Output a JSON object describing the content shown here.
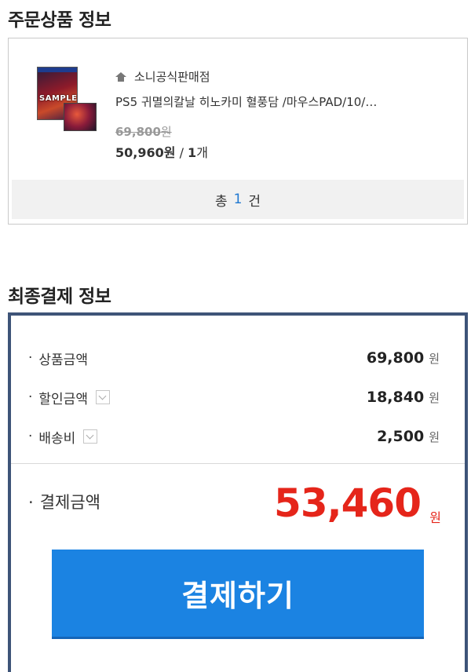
{
  "order_section": {
    "title": "주문상품 정보",
    "store_name": "소니공식판매점",
    "product_name": "PS5 귀멸의칼날 히노카미 혈풍담 /마우스PAD/10/…",
    "original_price": "69,800",
    "original_unit": "원",
    "sale_price": "50,960",
    "sale_unit": "원",
    "separator": " / ",
    "quantity": "1",
    "quantity_unit": "개",
    "thumbnail_icon": "product-thumbnail",
    "thumbnail_text": "SAMPLE",
    "total_prefix": "총",
    "total_count": "1",
    "total_suffix": "건"
  },
  "payment_section": {
    "title": "최종결제 정보",
    "rows": [
      {
        "label": "상품금액",
        "amount": "69,800",
        "unit": "원",
        "has_toggle": false
      },
      {
        "label": "할인금액",
        "amount": "18,840",
        "unit": "원",
        "has_toggle": true
      },
      {
        "label": "배송비",
        "amount": "2,500",
        "unit": "원",
        "has_toggle": true
      }
    ],
    "bullet": "·",
    "final_label": "결제금액",
    "final_amount": "53,460",
    "final_unit": "원",
    "pay_button_label": "결제하기"
  },
  "colors": {
    "accent_blue": "#1b83e2",
    "final_red": "#e5251a",
    "pay_box_border": "#3e5478",
    "count_blue": "#1f78d1"
  }
}
